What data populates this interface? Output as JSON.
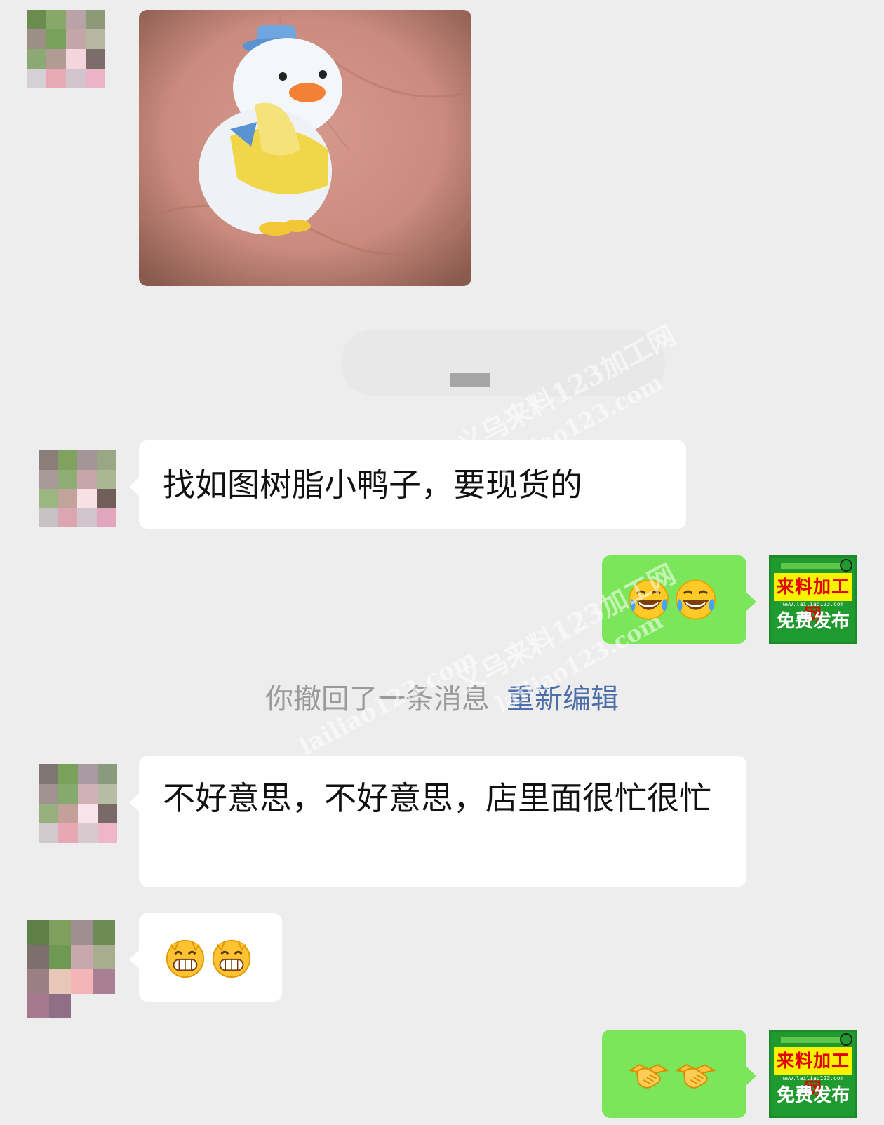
{
  "messages": {
    "m2_text": "找如图树脂小鸭子，要现货的",
    "m4_text": "不好意思，不好意思，店里面很忙很忙"
  },
  "system_note": {
    "text": "你撤回了一条消息",
    "action": "重新编辑"
  },
  "ad_avatar": {
    "title": "来料加工网",
    "url": "www.lailiao123.com",
    "subtitle": "免费发布"
  },
  "watermark": {
    "line1": "义乌来料123加工网",
    "line2": "lailiao123.com"
  },
  "colors": {
    "chat_background": "#ededed",
    "incoming_bubble": "#ffffff",
    "outgoing_bubble": "#7ce65a",
    "link": "#4d6ea8"
  },
  "icons": {
    "emoji_1": "tears-of-joy-icon",
    "emoji_2": "grinning-icon",
    "emoji_3": "handshake-icon"
  }
}
